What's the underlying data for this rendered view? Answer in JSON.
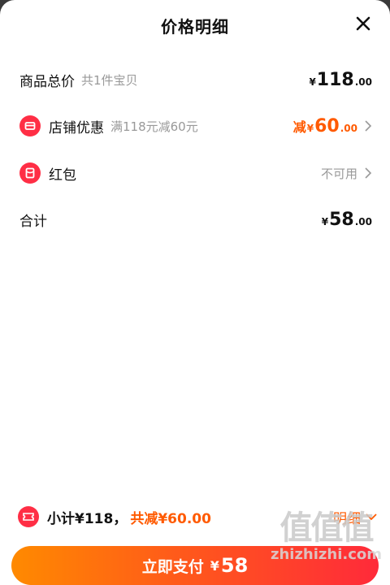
{
  "header": {
    "title": "价格明细"
  },
  "rows": {
    "goods": {
      "label": "商品总价",
      "sub": "共1件宝贝",
      "yen": "¥",
      "int": "118",
      "dec": ".00"
    },
    "shop": {
      "label": "店铺优惠",
      "sub": "满118元减60元",
      "prefix": "减",
      "yen": "¥",
      "int": "60",
      "dec": ".00"
    },
    "redpacket": {
      "label": "红包",
      "value": "不可用"
    },
    "total": {
      "label": "合计",
      "yen": "¥",
      "int": "58",
      "dec": ".00"
    }
  },
  "footer": {
    "subtotal": "小计¥118，",
    "total_save": "共减¥60.00",
    "detail_label": "明细"
  },
  "pay_button": {
    "label": "立即支付",
    "yen": "¥",
    "amount": "58"
  },
  "watermark": {
    "glyphs": "值值值",
    "url": "zhizhizhi.com"
  },
  "colors": {
    "accent": "#ff5a00",
    "red": "#ff2e45",
    "gradient_start": "#ff8a00",
    "gradient_end": "#ff2a3a"
  },
  "icons": [
    "close-icon",
    "shop-icon",
    "red-packet-icon",
    "chevron-right-icon",
    "coupon-ticket-icon",
    "chevron-down-icon"
  ]
}
